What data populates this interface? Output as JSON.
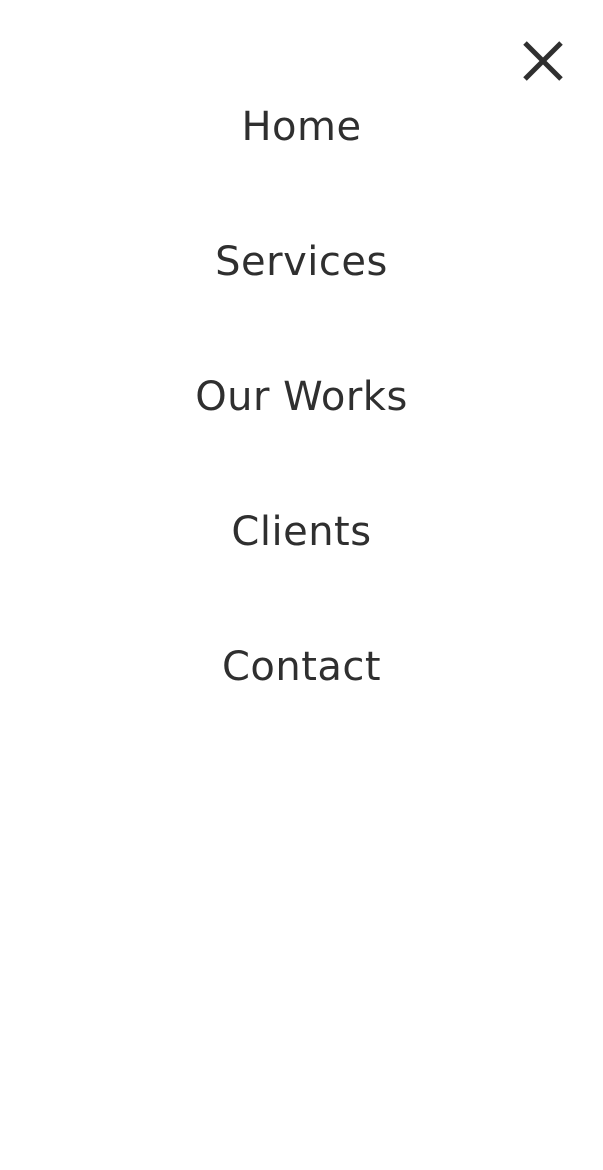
{
  "menu": {
    "close_icon": "close-icon",
    "items": [
      {
        "label": "Home"
      },
      {
        "label": "Services"
      },
      {
        "label": "Our Works"
      },
      {
        "label": "Clients"
      },
      {
        "label": "Contact"
      }
    ]
  },
  "colors": {
    "background": "#ffffff",
    "text": "#2f2f2f"
  }
}
